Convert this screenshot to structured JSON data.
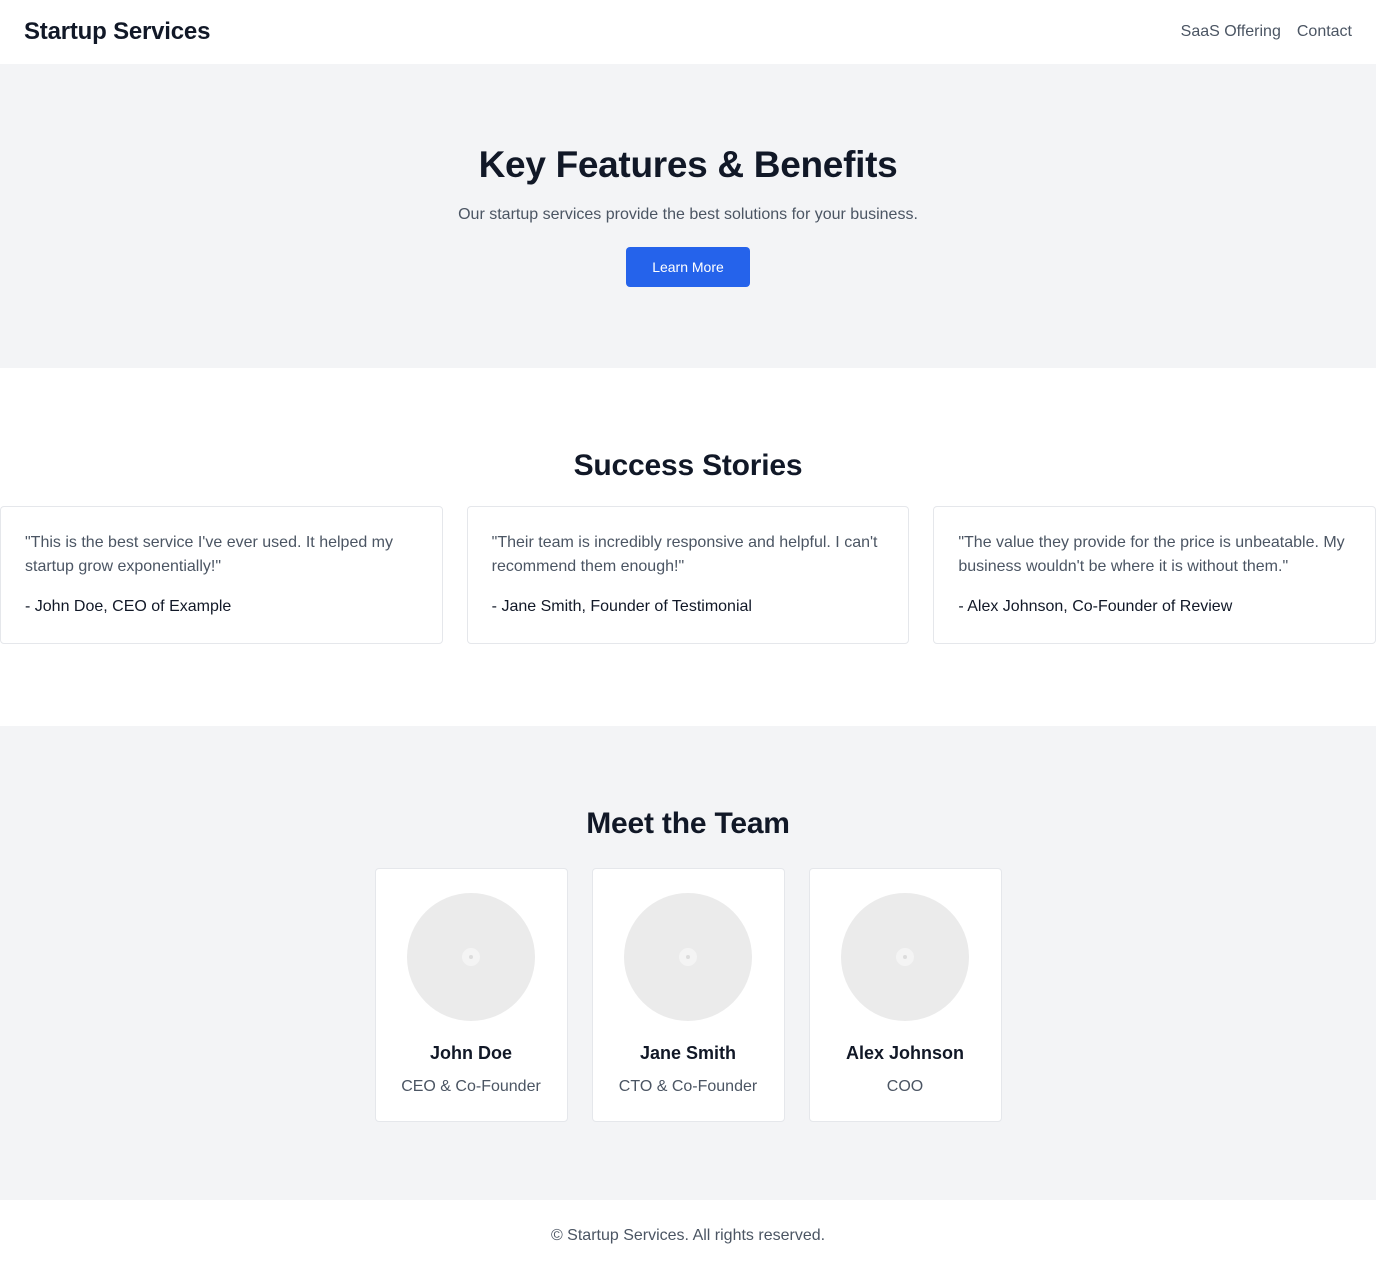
{
  "header": {
    "brand": "Startup Services",
    "nav": [
      {
        "label": "SaaS Offering"
      },
      {
        "label": "Contact"
      }
    ]
  },
  "hero": {
    "title": "Key Features & Benefits",
    "subtitle": "Our startup services provide the best solutions for your business.",
    "cta_label": "Learn More"
  },
  "testimonials": {
    "title": "Success Stories",
    "items": [
      {
        "quote": "\"This is the best service I've ever used. It helped my startup grow exponentially!\"",
        "author": "- John Doe, CEO of Example"
      },
      {
        "quote": "\"Their team is incredibly responsive and helpful. I can't recommend them enough!\"",
        "author": "- Jane Smith, Founder of Testimonial"
      },
      {
        "quote": "\"The value they provide for the price is unbeatable. My business wouldn't be where it is without them.\"",
        "author": "- Alex Johnson, Co-Founder of Review"
      }
    ]
  },
  "team": {
    "title": "Meet the Team",
    "members": [
      {
        "name": "John Doe",
        "role": "CEO & Co-Founder",
        "avatar_icon": "image-placeholder-icon"
      },
      {
        "name": "Jane Smith",
        "role": "CTO & Co-Founder",
        "avatar_icon": "image-placeholder-icon"
      },
      {
        "name": "Alex Johnson",
        "role": "COO",
        "avatar_icon": "image-placeholder-icon"
      }
    ]
  },
  "footer": {
    "copyright": "© Startup Services. All rights reserved."
  },
  "colors": {
    "accent": "#2563eb",
    "section_bg": "#f3f4f6",
    "text_primary": "#111827",
    "text_secondary": "#4b5563",
    "border": "#e5e7eb"
  }
}
